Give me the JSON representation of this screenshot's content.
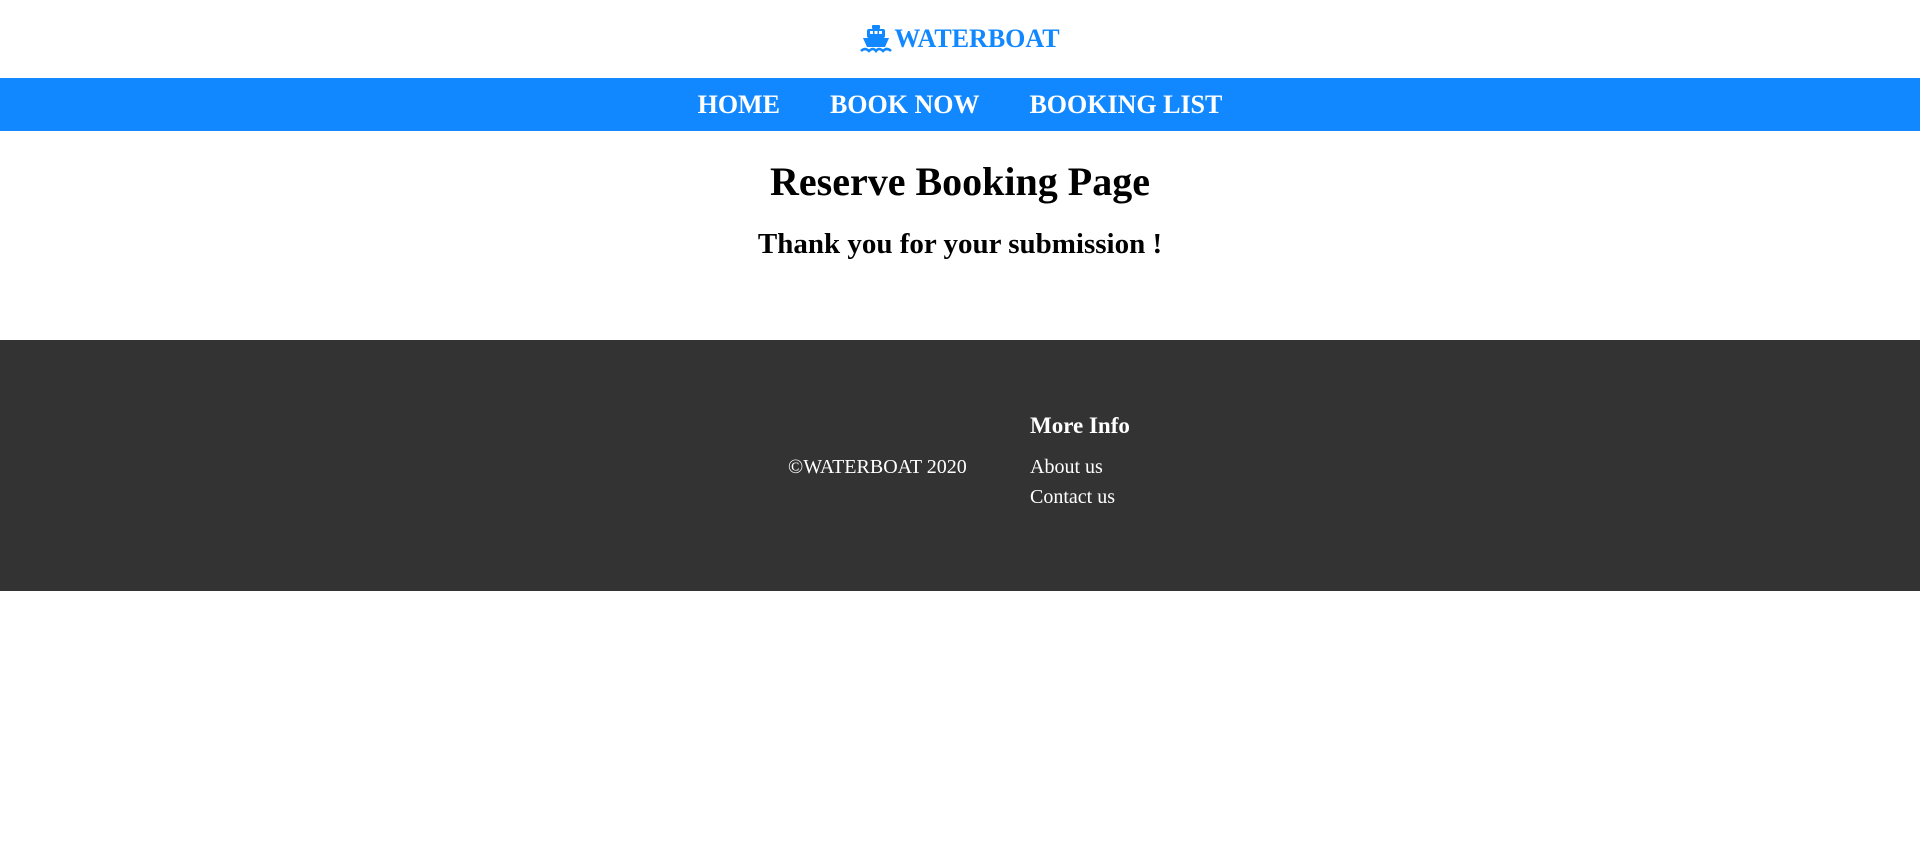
{
  "header": {
    "brand_name": "WATERBOAT",
    "brand_icon": "ship-icon",
    "brand_color": "#1188ff"
  },
  "nav": {
    "background_color": "#1188ff",
    "items": [
      {
        "label": "HOME"
      },
      {
        "label": "BOOK NOW"
      },
      {
        "label": "BOOKING LIST"
      }
    ]
  },
  "main": {
    "title": "Reserve Booking Page",
    "message": "Thank you for your submission !"
  },
  "footer": {
    "background_color": "#333333",
    "copyright": "©WATERBOAT 2020",
    "more_info": {
      "title": "More Info",
      "links": [
        {
          "label": "About us"
        },
        {
          "label": "Contact us"
        }
      ]
    }
  }
}
